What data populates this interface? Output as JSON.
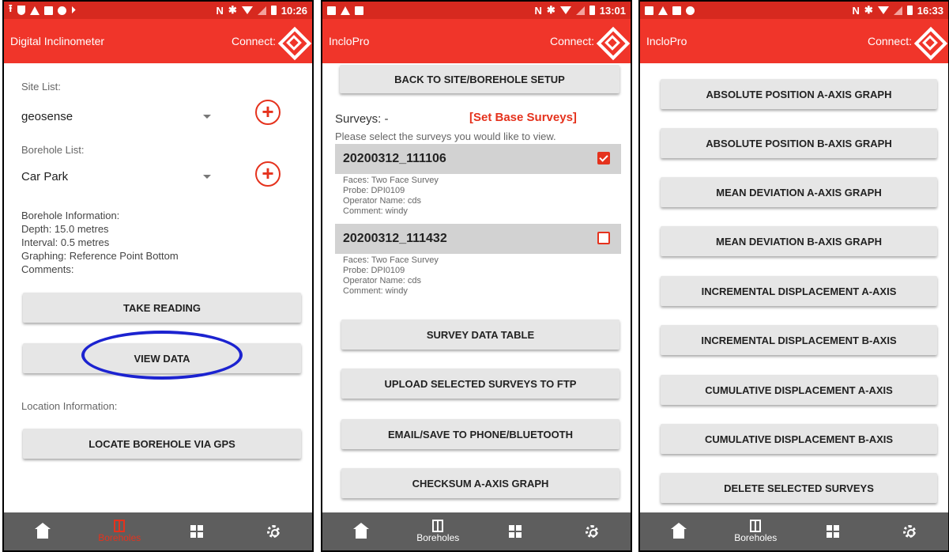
{
  "status_bars": [
    {
      "time": "10:26"
    },
    {
      "time": "13:01"
    },
    {
      "time": "16:33"
    }
  ],
  "phone1": {
    "app_title": "Digital Inclinometer",
    "connect_label": "Connect:",
    "site_list_label": "Site List:",
    "site_value": "geosense",
    "borehole_list_label": "Borehole List:",
    "borehole_value": "Car Park",
    "borehole_info": {
      "heading": "Borehole Information:",
      "depth": "Depth: 15.0 metres",
      "interval": "Interval: 0.5 metres",
      "graphing": "Graphing: Reference Point Bottom",
      "comments": "Comments:"
    },
    "take_reading": "TAKE READING",
    "view_data": "VIEW DATA",
    "location_label": "Location Information:",
    "locate_gps": "LOCATE BOREHOLE VIA GPS",
    "nav": {
      "boreholes": "Boreholes"
    }
  },
  "phone2": {
    "app_title": "IncloPro",
    "connect_label": "Connect:",
    "back_button": "BACK TO SITE/BOREHOLE SETUP",
    "surveys_label": "Surveys: -",
    "set_base": "[Set Base Surveys]",
    "instruction": "Please select the surveys you would like to view.",
    "surveys": [
      {
        "id": "20200312_111106",
        "checked": true,
        "faces": "Faces: Two Face Survey",
        "probe": "Probe: DPI0109",
        "operator": "Operator Name: cds",
        "comment": "Comment: windy"
      },
      {
        "id": "20200312_111432",
        "checked": false,
        "faces": "Faces: Two Face Survey",
        "probe": "Probe: DPI0109",
        "operator": "Operator Name: cds",
        "comment": "Comment: windy"
      }
    ],
    "buttons": [
      "SURVEY DATA TABLE",
      "UPLOAD SELECTED SURVEYS TO FTP",
      "EMAIL/SAVE TO PHONE/BLUETOOTH",
      "CHECKSUM A-AXIS GRAPH"
    ],
    "nav": {
      "boreholes": "Boreholes"
    }
  },
  "phone3": {
    "app_title": "IncloPro",
    "connect_label": "Connect:",
    "buttons": [
      "ABSOLUTE POSITION A-AXIS GRAPH",
      "ABSOLUTE POSITION B-AXIS GRAPH",
      "MEAN DEVIATION A-AXIS GRAPH",
      "MEAN DEVIATION B-AXIS GRAPH",
      "INCREMENTAL DISPLACEMENT A-AXIS",
      "INCREMENTAL DISPLACEMENT B-AXIS",
      "CUMULATIVE DISPLACEMENT A-AXIS",
      "CUMULATIVE DISPLACEMENT B-AXIS",
      "DELETE SELECTED SURVEYS"
    ],
    "nav": {
      "boreholes": "Boreholes"
    }
  },
  "colors": {
    "status_bar": "#d7291f",
    "app_bar": "#f0352a",
    "accent": "#e5321d",
    "nav_bar": "#5e5e5e",
    "highlight": "#1c23d0"
  }
}
